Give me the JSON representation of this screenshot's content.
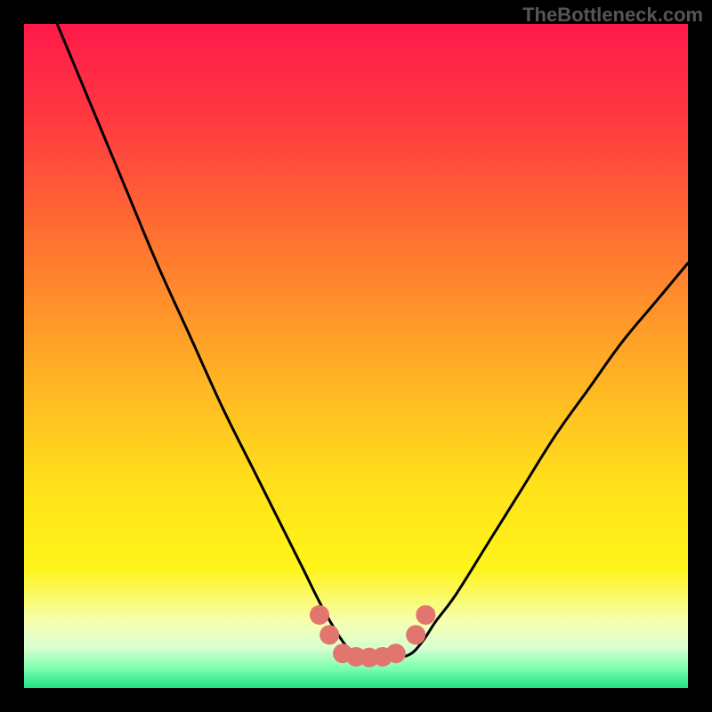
{
  "watermark": "TheBottleneck.com",
  "gradient_stops": [
    {
      "pct": 0,
      "color": "#ff1a4b"
    },
    {
      "pct": 15,
      "color": "#ff3b3f"
    },
    {
      "pct": 35,
      "color": "#ff7a2f"
    },
    {
      "pct": 55,
      "color": "#ffb824"
    },
    {
      "pct": 70,
      "color": "#ffe21a"
    },
    {
      "pct": 82,
      "color": "#fff41a"
    },
    {
      "pct": 90,
      "color": "#f6ffb0"
    },
    {
      "pct": 94,
      "color": "#d8ffd0"
    },
    {
      "pct": 97,
      "color": "#7dffb0"
    },
    {
      "pct": 100,
      "color": "#22e083"
    }
  ],
  "curve_color": "#000000",
  "curve_width": 3,
  "marker": {
    "fill": "#e2766e",
    "radius": 11
  },
  "chart_data": {
    "type": "line",
    "title": "",
    "xlabel": "",
    "ylabel": "",
    "xlim": [
      0,
      100
    ],
    "ylim": [
      0,
      100
    ],
    "grid": false,
    "series": [
      {
        "name": "bottleneck-curve",
        "x": [
          5,
          10,
          15,
          20,
          25,
          30,
          35,
          40,
          42,
          45,
          48,
          50,
          52,
          55,
          58,
          60,
          62,
          65,
          70,
          75,
          80,
          85,
          90,
          95,
          100
        ],
        "y": [
          100,
          88,
          76,
          64,
          53,
          42,
          32,
          22,
          18,
          12,
          7,
          5,
          4.5,
          4.5,
          5,
          7,
          10,
          14,
          22,
          30,
          38,
          45,
          52,
          58,
          64
        ]
      }
    ],
    "markers": {
      "name": "bottom-beads",
      "x": [
        44.5,
        46,
        48,
        50,
        52,
        54,
        56,
        59,
        60.5
      ],
      "y": [
        11,
        8,
        5.2,
        4.7,
        4.6,
        4.7,
        5.2,
        8,
        11
      ]
    }
  }
}
